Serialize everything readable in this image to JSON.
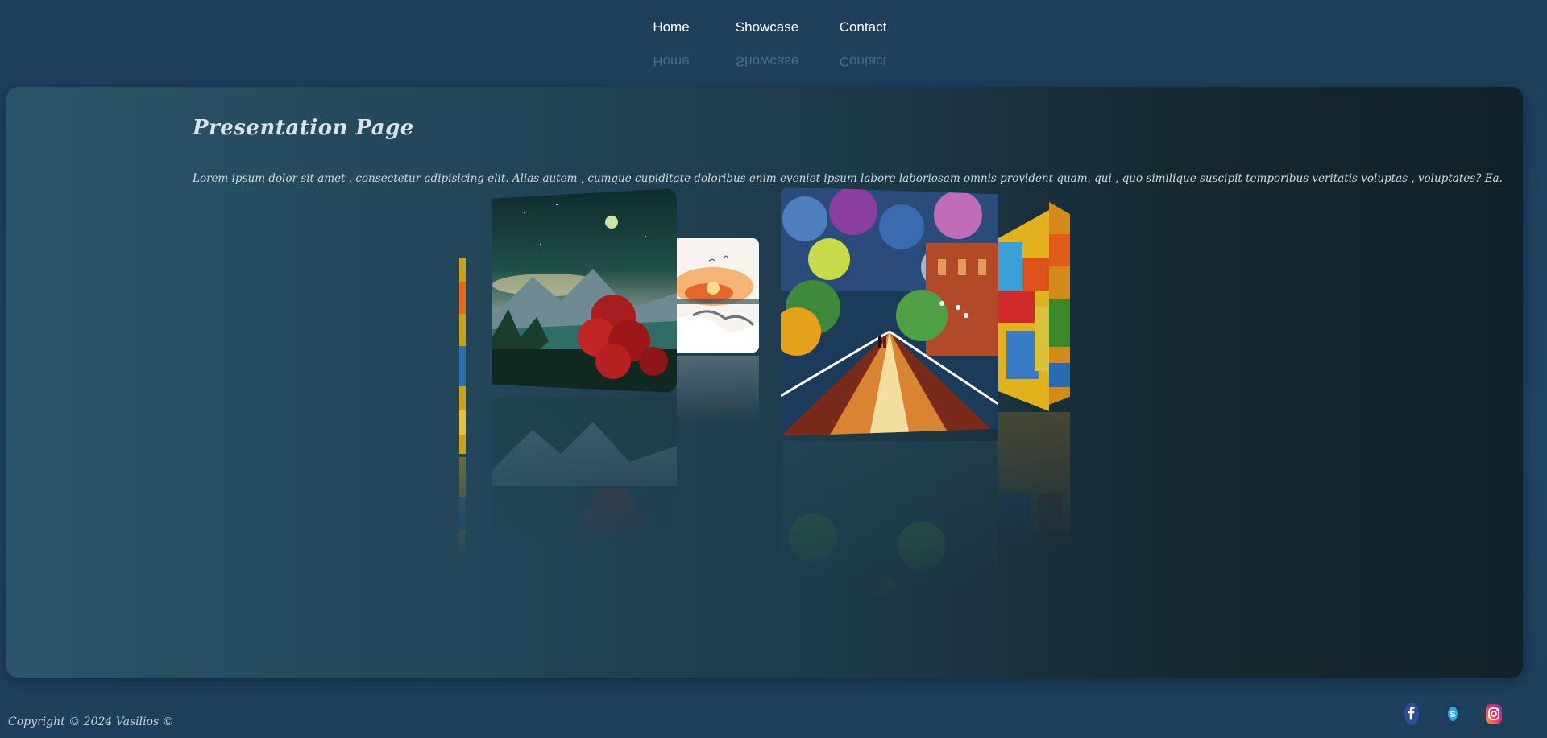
{
  "nav": {
    "items": [
      {
        "label": "Home"
      },
      {
        "label": "Showcase"
      },
      {
        "label": "Contact"
      }
    ]
  },
  "main": {
    "title": "Presentation Page",
    "lead": "Lorem ipsum dolor sit amet , consectetur adipisicing elit. Alias autem , cumque cupiditate doloribus enim eveniet ipsum labore laboriosam omnis provident quam, qui , quo similique suscipit temporibus veritatis voluptas , voluptates? Ea.",
    "gallery": [
      {
        "name": "abstract-edge-painting"
      },
      {
        "name": "starry-mountain-painting"
      },
      {
        "name": "sunset-watercolor-painting"
      },
      {
        "name": "rainy-park-painting"
      },
      {
        "name": "colorful-street-painting"
      }
    ]
  },
  "footer": {
    "copyright": "Copyright © 2024 Vasilios ©",
    "socials": [
      {
        "icon": "facebook-icon",
        "color": "#3b5998"
      },
      {
        "icon": "skype-icon",
        "color": "#2aa7e0"
      },
      {
        "icon": "instagram-icon",
        "color": "#d6249f"
      }
    ]
  }
}
